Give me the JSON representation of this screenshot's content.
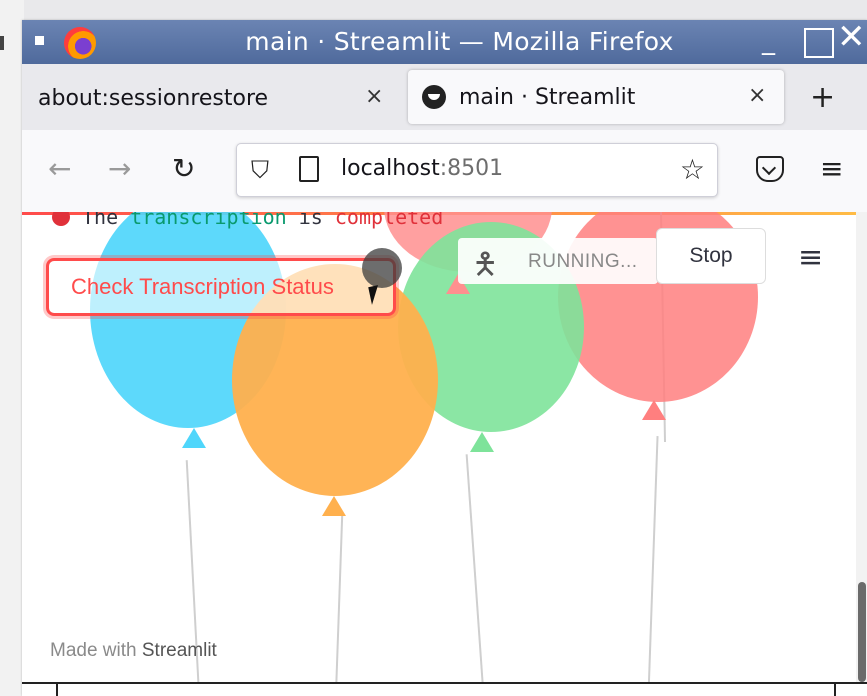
{
  "window": {
    "title": "main · Streamlit — Mozilla Firefox",
    "minimize_glyph": "_",
    "close_glyph": "✕"
  },
  "tabs": [
    {
      "label": "about:sessionrestore",
      "close": "×"
    },
    {
      "label": "main · Streamlit",
      "close": "×",
      "active": true
    }
  ],
  "new_tab_glyph": "+",
  "nav": {
    "back": "←",
    "forward": "→",
    "reload": "↻",
    "url_host": "localhost",
    "url_port": ":8501",
    "bookmark_star": "☆",
    "menu": "≡"
  },
  "app": {
    "status_message_prefix": "The ",
    "status_message_code1": "transcription",
    "status_message_mid": " is ",
    "status_message_code2": "completed",
    "check_button": "Check Transcription Status",
    "running_label": "RUNNING...",
    "stop_button": "Stop",
    "main_menu": "≡",
    "footer_prefix": "Made with ",
    "footer_brand": "Streamlit"
  },
  "balloons": [
    {
      "color": "#4fd6fb"
    },
    {
      "color": "#ffb04d"
    },
    {
      "color": "#7ee39a"
    },
    {
      "color": "#ff7f7f"
    }
  ],
  "icons": [
    "firefox-logo-icon",
    "tab-favicon-icon",
    "shield-icon",
    "page-icon",
    "star-icon",
    "pocket-icon",
    "hamburger-menu-icon",
    "running-person-icon"
  ]
}
